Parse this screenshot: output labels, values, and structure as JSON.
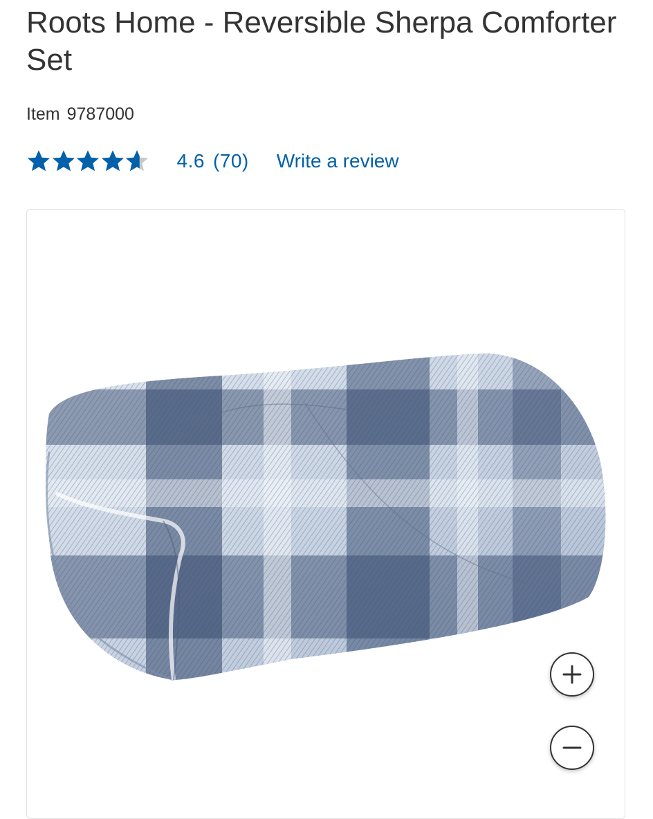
{
  "product": {
    "title": "Roots Home - Reversible Sherpa Comforter Set",
    "item_label": "Item",
    "item_number": "9787000"
  },
  "rating": {
    "stars_value": 4.6,
    "stars_max": 5,
    "average": "4.6",
    "count": "(70)",
    "write_review_label": "Write a review"
  },
  "image_viewer": {
    "image_alt": "Blue and white plaid folded comforter",
    "zoom_in_icon": "plus-icon",
    "zoom_out_icon": "minus-icon"
  },
  "colors": {
    "link_blue": "#0060a9",
    "star_blue": "#0060a9",
    "text": "#333333"
  }
}
